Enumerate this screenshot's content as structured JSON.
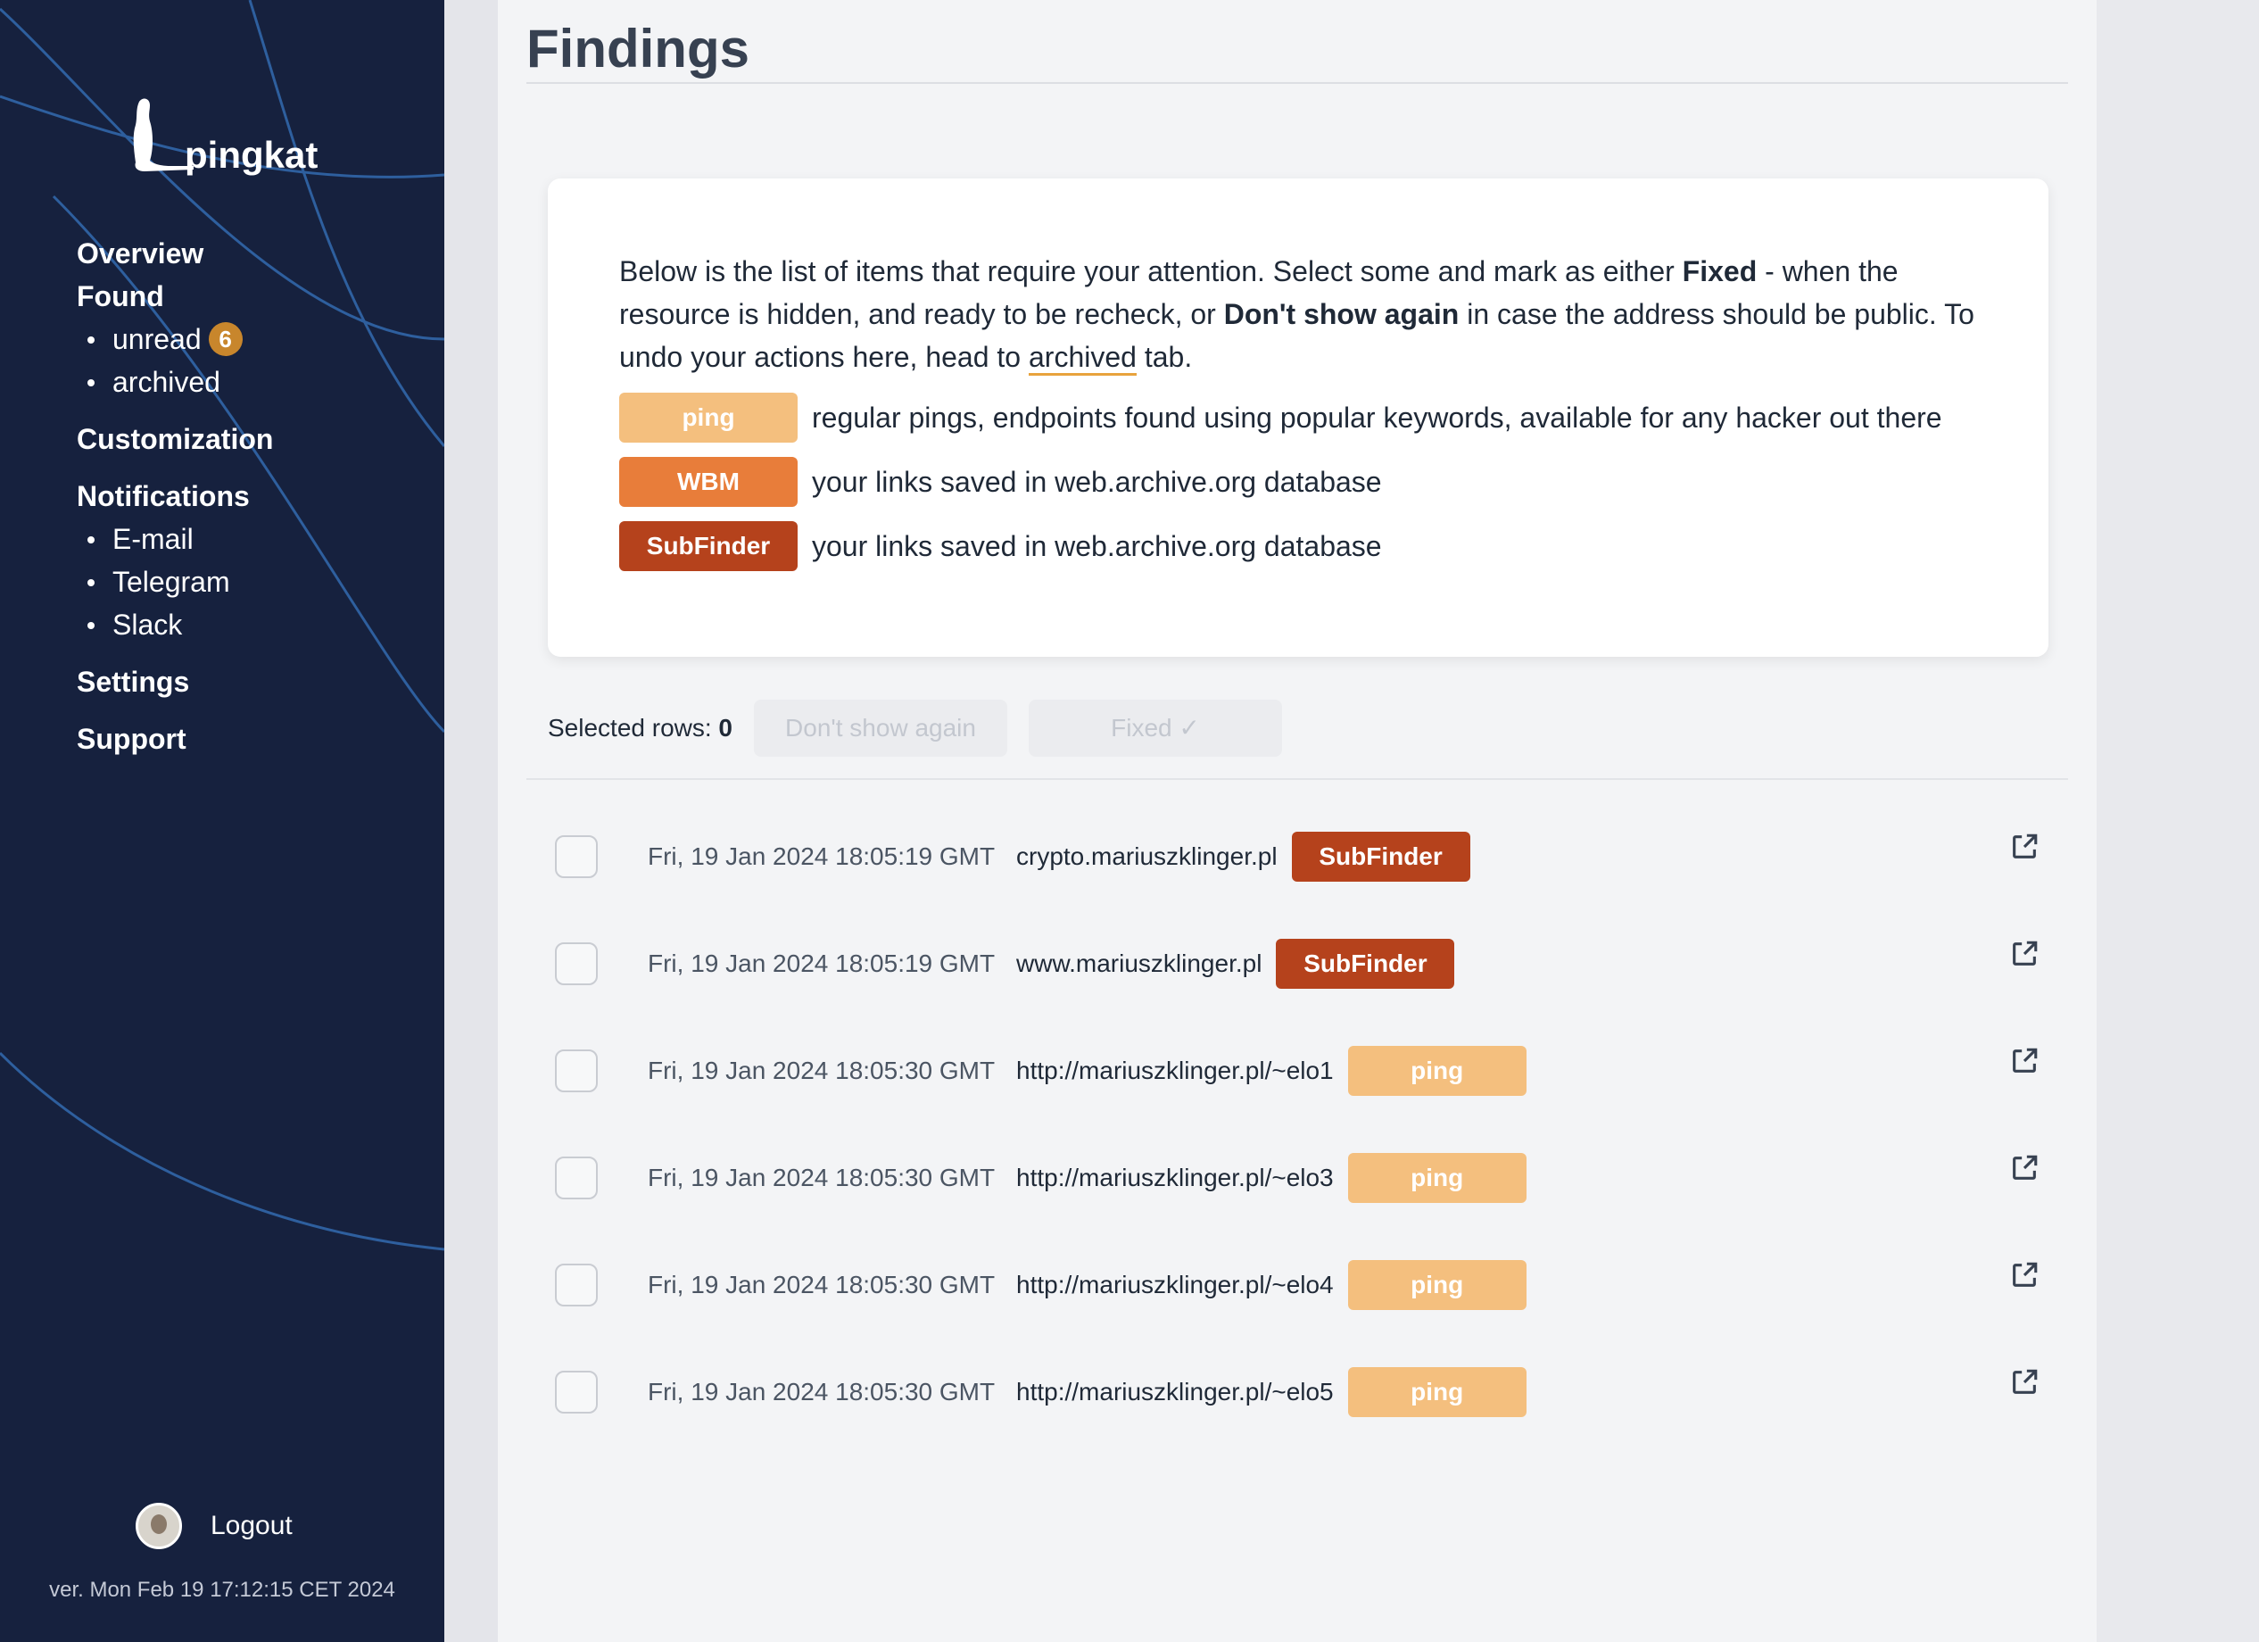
{
  "app": {
    "name": "pingkat"
  },
  "sidebar": {
    "nav": {
      "overview": "Overview",
      "found": "Found",
      "unread": "unread",
      "unread_count": "6",
      "archived": "archived",
      "customization": "Customization",
      "notifications": "Notifications",
      "email": "E-mail",
      "telegram": "Telegram",
      "slack": "Slack",
      "settings": "Settings",
      "support": "Support"
    },
    "logout": "Logout",
    "version": "ver. Mon Feb 19 17:12:15 CET 2024"
  },
  "page": {
    "title": "Findings"
  },
  "info": {
    "p1": "Below is the list of items that require your attention. Select some and mark as either ",
    "fixed": "Fixed",
    "p2": " - when the resource is hidden, and ready to be recheck, or ",
    "dont_show": "Don't show again",
    "p3": " in case the address should be public. To undo your actions here, head to ",
    "archived_link": "archived",
    "p4": " tab.",
    "legend": [
      {
        "tag": "ping",
        "desc": "regular pings, endpoints found using popular keywords, available for any hacker out there"
      },
      {
        "tag": "WBM",
        "desc": "your links saved in web.archive.org database"
      },
      {
        "tag": "SubFinder",
        "desc": "your links saved in web.archive.org database"
      }
    ]
  },
  "toolbar": {
    "selected_label": "Selected rows:",
    "selected_count": "0",
    "dont_show_btn": "Don't show again",
    "fixed_btn": "Fixed ✓"
  },
  "findings": [
    {
      "date": "Fri, 19 Jan 2024 18:05:19 GMT",
      "url": "crypto.mariuszklinger.pl",
      "tag": "SubFinder",
      "type": "subfinder"
    },
    {
      "date": "Fri, 19 Jan 2024 18:05:19 GMT",
      "url": "www.mariuszklinger.pl",
      "tag": "SubFinder",
      "type": "subfinder"
    },
    {
      "date": "Fri, 19 Jan 2024 18:05:30 GMT",
      "url": "http://mariuszklinger.pl/~elo1",
      "tag": "ping",
      "type": "ping"
    },
    {
      "date": "Fri, 19 Jan 2024 18:05:30 GMT",
      "url": "http://mariuszklinger.pl/~elo3",
      "tag": "ping",
      "type": "ping"
    },
    {
      "date": "Fri, 19 Jan 2024 18:05:30 GMT",
      "url": "http://mariuszklinger.pl/~elo4",
      "tag": "ping",
      "type": "ping"
    },
    {
      "date": "Fri, 19 Jan 2024 18:05:30 GMT",
      "url": "http://mariuszklinger.pl/~elo5",
      "tag": "ping",
      "type": "ping"
    }
  ],
  "colors": {
    "sidebar_bg": "#16213e",
    "ping": "#f4bf7e",
    "wbm": "#e87d3a",
    "subfinder": "#b5421c",
    "accent": "#e8a33d"
  },
  "icons": {
    "external_link": "external-link-icon",
    "logo": "meerkat-logo-icon"
  }
}
